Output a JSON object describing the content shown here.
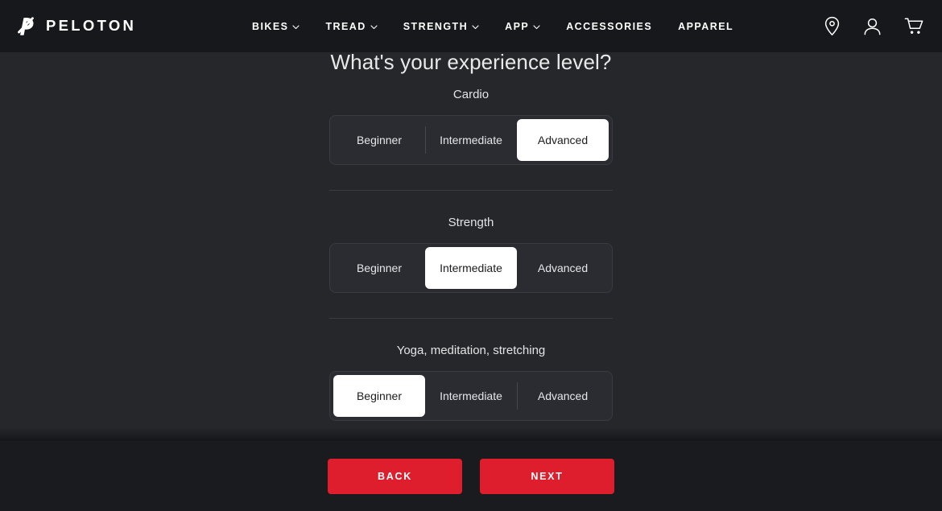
{
  "header": {
    "brand": "PELOTON",
    "logo_icon": "peloton-logo-icon",
    "nav": [
      {
        "label": "BIKES",
        "has_chevron": true
      },
      {
        "label": "TREAD",
        "has_chevron": true
      },
      {
        "label": "STRENGTH",
        "has_chevron": true
      },
      {
        "label": "APP",
        "has_chevron": true
      },
      {
        "label": "ACCESSORIES",
        "has_chevron": false
      },
      {
        "label": "APPAREL",
        "has_chevron": false
      }
    ],
    "icons": [
      {
        "name": "location-pin-icon"
      },
      {
        "name": "account-person-icon"
      },
      {
        "name": "shopping-cart-icon"
      }
    ]
  },
  "main": {
    "title": "What's your experience level?",
    "groups": [
      {
        "label": "Cardio",
        "options": [
          "Beginner",
          "Intermediate",
          "Advanced"
        ],
        "selected": "Advanced"
      },
      {
        "label": "Strength",
        "options": [
          "Beginner",
          "Intermediate",
          "Advanced"
        ],
        "selected": "Intermediate"
      },
      {
        "label": "Yoga, meditation, stretching",
        "options": [
          "Beginner",
          "Intermediate",
          "Advanced"
        ],
        "selected": "Beginner"
      }
    ]
  },
  "footer": {
    "back_label": "BACK",
    "next_label": "NEXT"
  },
  "colors": {
    "brand_red": "#df1e2d",
    "header_bg": "#17181b",
    "page_bg": "#26272b",
    "footer_bg": "#1a1b1e",
    "track_bg": "#2b2c31",
    "selected_bg": "#ffffff"
  }
}
